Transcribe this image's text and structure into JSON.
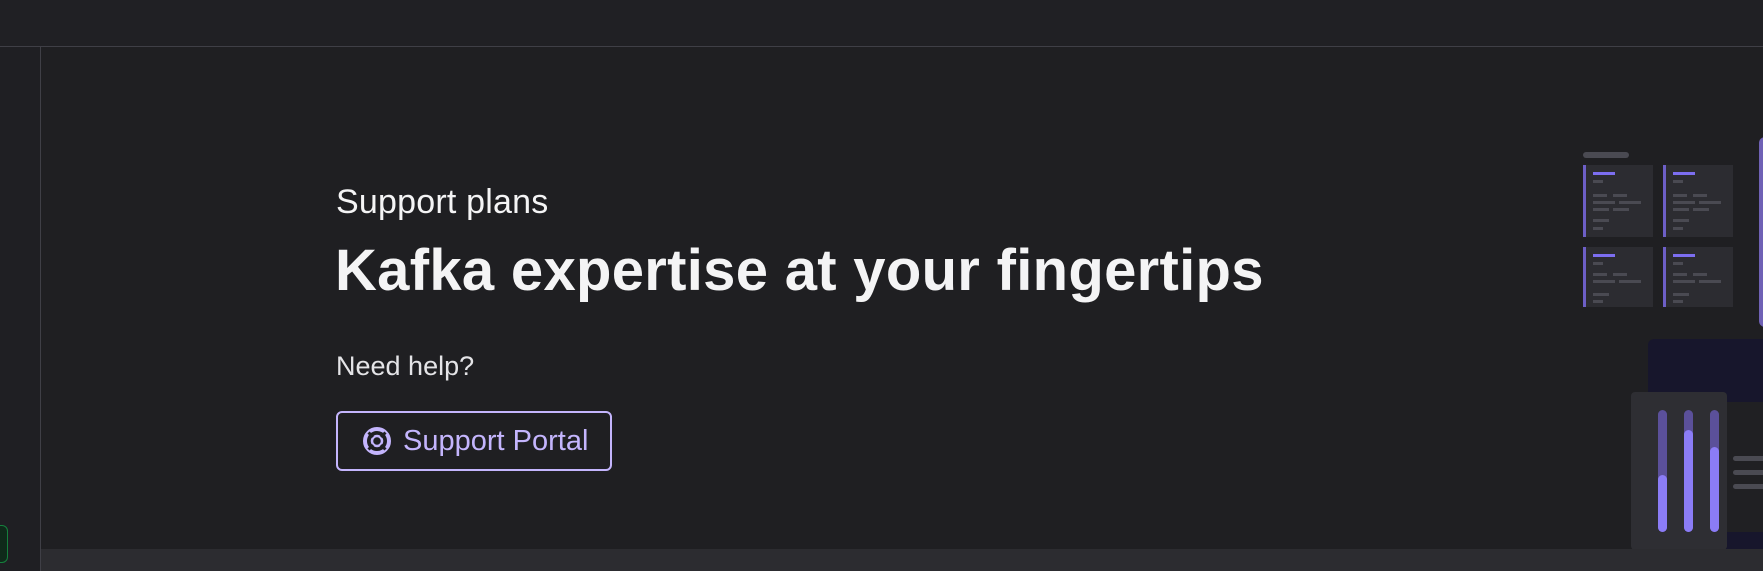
{
  "header": {
    "subtitle": "Support plans",
    "headline": "Kafka expertise at your fingertips"
  },
  "help": {
    "prompt": "Need help?",
    "button_label": "Support Portal",
    "button_icon": "lifebuoy-icon"
  },
  "colors": {
    "background": "#1f1f22",
    "text": "#f4f4f5",
    "accent": "#c4b5fd",
    "accent_strong": "#8b7cf6",
    "sidebar_status": "#15803d"
  }
}
